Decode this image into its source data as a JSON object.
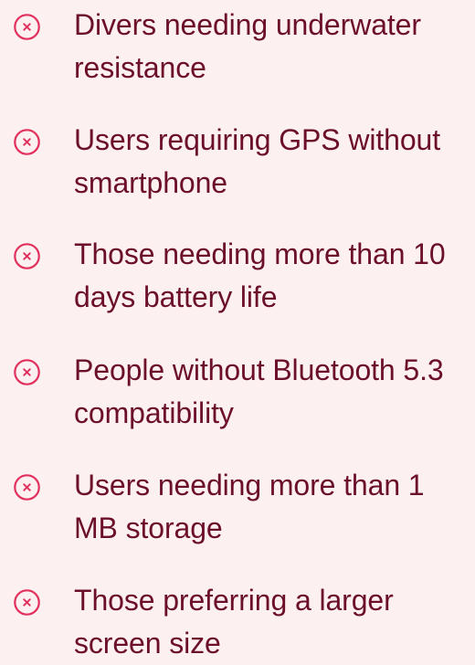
{
  "accent_color": "#e2305c",
  "text_color": "#6b0f2a",
  "background_color": "#fdf0f1",
  "items": [
    {
      "icon": "close-circle-icon",
      "label": "Divers needing underwater resistance"
    },
    {
      "icon": "close-circle-icon",
      "label": "Users requiring GPS without smartphone"
    },
    {
      "icon": "close-circle-icon",
      "label": "Those needing more than 10 days battery life"
    },
    {
      "icon": "close-circle-icon",
      "label": "People without Bluetooth 5.3 compatibility"
    },
    {
      "icon": "close-circle-icon",
      "label": "Users needing more than 1 MB storage"
    },
    {
      "icon": "close-circle-icon",
      "label": "Those preferring a larger screen size"
    }
  ]
}
